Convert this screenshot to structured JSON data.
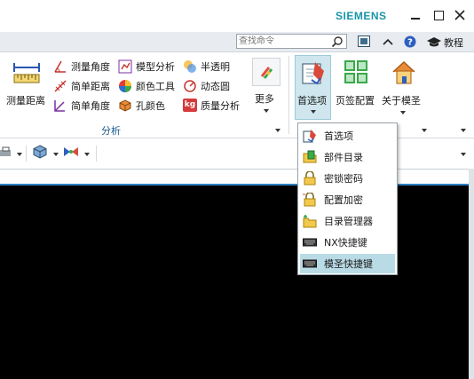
{
  "window": {
    "brand": "SIEMENS"
  },
  "search": {
    "placeholder": "查找命令"
  },
  "help": {
    "tutorial_label": "教程"
  },
  "ribbon": {
    "measure_distance": "测量距离",
    "measure_angle": "测量角度",
    "simple_distance": "简单距离",
    "simple_angle": "简单角度",
    "model_analysis": "模型分析",
    "color_tool": "颜色工具",
    "hole_color": "孔颜色",
    "semi_transparent": "半透明",
    "dynamic_circle": "动态圆",
    "mass_analysis": "质量分析",
    "more": "更多",
    "preferences": "首选项",
    "page_config": "页签配置",
    "about": "关于模圣",
    "group_analysis": "分析",
    "kg_badge": "kg"
  },
  "menu": {
    "items": [
      {
        "label": "首选项",
        "icon": "preferences-icon"
      },
      {
        "label": "部件目录",
        "icon": "part-catalog-icon"
      },
      {
        "label": "密锁密码",
        "icon": "lock-password-icon"
      },
      {
        "label": "配置加密",
        "icon": "config-encrypt-icon"
      },
      {
        "label": "目录管理器",
        "icon": "directory-manager-icon"
      },
      {
        "label": "NX快捷键",
        "icon": "keyboard-icon"
      },
      {
        "label": "模圣快捷键",
        "icon": "keyboard-icon"
      }
    ],
    "highlighted_index": 6
  },
  "colors": {
    "brand": "#1795a8",
    "highlight": "#b9dbe6",
    "graphics_bg": "#000000"
  }
}
